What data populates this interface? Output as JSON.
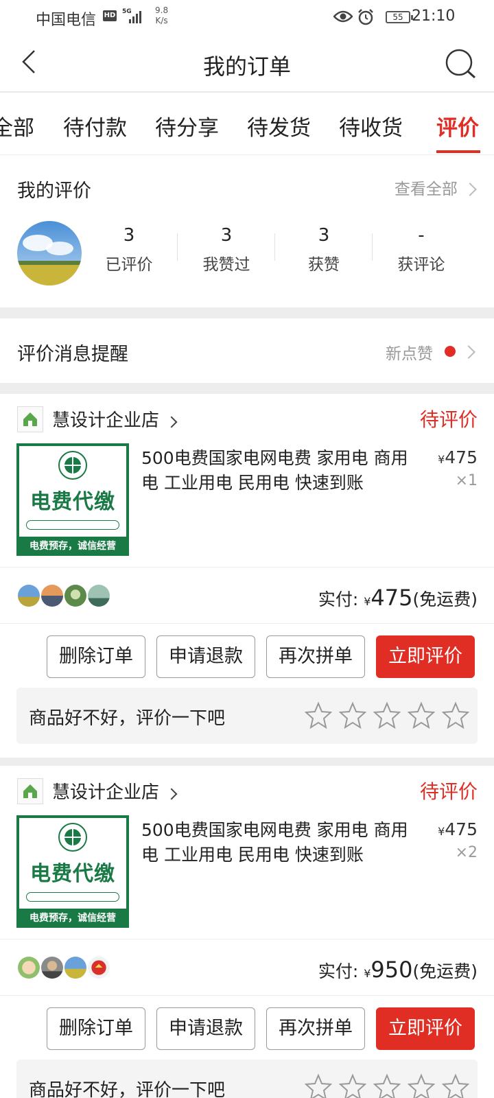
{
  "status_bar": {
    "carrier": "中国电信",
    "hd": "HD",
    "network": "5G",
    "speed_value": "9.8",
    "speed_unit": "K/s",
    "battery": "55",
    "time": "21:10"
  },
  "header": {
    "title": "我的订单"
  },
  "tabs": [
    {
      "label": "全部",
      "active": false
    },
    {
      "label": "待付款",
      "active": false
    },
    {
      "label": "待分享",
      "active": false
    },
    {
      "label": "待发货",
      "active": false
    },
    {
      "label": "待收货",
      "active": false
    },
    {
      "label": "评价",
      "active": true
    }
  ],
  "my_reviews": {
    "title": "我的评价",
    "view_all": "查看全部",
    "stats": [
      {
        "value": "3",
        "label": "已评价"
      },
      {
        "value": "3",
        "label": "我赞过"
      },
      {
        "value": "3",
        "label": "获赞"
      },
      {
        "value": "-",
        "label": "获评论"
      }
    ]
  },
  "reminder": {
    "title": "评价消息提醒",
    "tag": "新点赞"
  },
  "orders": [
    {
      "shop": "慧设计企业店",
      "status": "待评价",
      "thumb_title": "电费代缴",
      "thumb_footer": "电费预存，诚信经营",
      "product_title": "500电费国家电网电费 家用电 商用电 工业用电 民用电 快速到账",
      "currency": "¥",
      "price": "475",
      "quantity": "×1",
      "paid_label": "实付:",
      "paid_amount": "475",
      "shipping": "(免运费)",
      "buttons": [
        "删除订单",
        "申请退款",
        "再次拼单",
        "立即评价"
      ],
      "rate_prompt": "商品好不好，评价一下吧",
      "stars": 0
    },
    {
      "shop": "慧设计企业店",
      "status": "待评价",
      "thumb_title": "电费代缴",
      "thumb_footer": "电费预存，诚信经营",
      "product_title": "500电费国家电网电费 家用电 商用电 工业用电 民用电 快速到账",
      "currency": "¥",
      "price": "475",
      "quantity": "×2",
      "paid_label": "实付:",
      "paid_amount": "950",
      "shipping": "(免运费)",
      "buttons": [
        "删除订单",
        "申请退款",
        "再次拼单",
        "立即评价"
      ],
      "rate_prompt": "商品好不好，评价一下吧",
      "stars": 0
    }
  ],
  "colors": {
    "accent": "#e02e24",
    "thumb_green": "#1a7a45"
  }
}
